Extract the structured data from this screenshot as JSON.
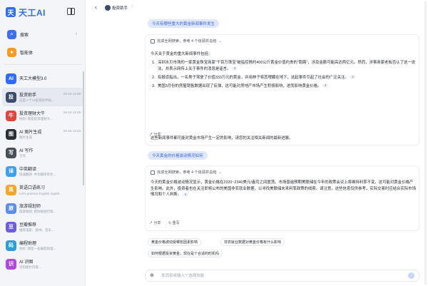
{
  "app": {
    "logo_text": "天工AI",
    "logo_mark": "天"
  },
  "sidebar": {
    "quick": [
      {
        "label": "搜索",
        "icon": "search-icon",
        "more": "›"
      },
      {
        "label": "智能体",
        "icon": "bolt-icon",
        "more": ""
      }
    ],
    "history": [
      {
        "title": "天工大模型3.0",
        "sub": "",
        "time": "",
        "color": "#2f6bff",
        "glyph": "AI",
        "active": false
      },
      {
        "title": "投资助手",
        "sub": "这是一个AI投资助手助...",
        "time": "04-16 13:48",
        "color": "#3b4b6b",
        "glyph": "投",
        "active": true
      },
      {
        "title": "投资理财大牛",
        "sub": "你好! 我是投资理财大...",
        "time": "04-16 13:45",
        "color": "#e0463c",
        "glyph": "牛",
        "active": false
      },
      {
        "title": "AI 图片生成",
        "sub": "图片生成",
        "time": "04-16 13:43",
        "color": "#2b2f36",
        "glyph": "图",
        "active": false
      },
      {
        "title": "AI 写作",
        "sub": "写作",
        "time": "",
        "color": "#4a4f57",
        "glyph": "写",
        "active": false
      },
      {
        "title": "中英翻译",
        "sub": "快速翻译: 中文翻译英文...",
        "time": "",
        "color": "#3aa0f0",
        "glyph": "译",
        "active": false
      },
      {
        "title": "英语口语练习",
        "sub": "Let's practice English togeth...",
        "time": "",
        "color": "#f5a623",
        "glyph": "英",
        "active": false
      },
      {
        "title": "旅游规划师",
        "sub": "旅游规划: 帮你规划行程...",
        "time": "",
        "color": "#5b8def",
        "glyph": "旅",
        "active": false
      },
      {
        "title": "豆瓣推荐",
        "sub": "推荐电影、图书、音乐...",
        "time": "",
        "color": "#6c5ce7",
        "glyph": "豆",
        "active": false
      },
      {
        "title": "编程助理",
        "sub": "你好, 我是一名编程助理...",
        "time": "",
        "color": "#2d9cdb",
        "glyph": "码",
        "active": false
      },
      {
        "title": "AI 识图",
        "sub": "识别图片内容...",
        "time": "",
        "color": "#b04adf",
        "glyph": "识",
        "active": false
      }
    ]
  },
  "header": {
    "back": "‹",
    "bot_name": "投资助手",
    "star": "☆"
  },
  "chat": {
    "q1": "今天有哪些重大的黄金新闻事件发生",
    "a1": {
      "refs": "完成全网搜索，参考 4 个信源并总结",
      "intro": "今天关于黄金的重大新闻事件包括：",
      "items": [
        {
          "n": "1.",
          "text": "深圳水贝市场的一家黄金珠宝商家“千百万珠宝”被指控携约400公斤黄金价值约贵的“跑路”，涉及金额可能高达两亿元。然而，涉事商家老板否认了这一说法，并表示网传上关于事件的消息是谣言。",
          "tag": "4"
        },
        {
          "n": "2.",
          "text": "有报道指出，一名男子驾驶了价值333万元的黄金，并用林子将其埋藏在地下，这起事件引起了社会的广泛关注。",
          "tag": "4"
        },
        {
          "n": "3.",
          "text": "美国3月份的房屋销售数据出现了反弹，这可能对房地产市场产生积极影响，进而影响黄金价格。",
          "tag": "4"
        }
      ],
      "outro": "这些新闻事件都可能对黄金市场产生一定的影响，请您的关注相关新闻的最新进展。",
      "share": "↗ 分享"
    },
    "q2": "今天黄金的价格波动情况如何",
    "a2": {
      "refs": "完成全网搜索，参考 4 个信源并总结",
      "text": "今天的黄金价格波动情况显示，黄金价格在2320~2340美元/盎司之间震荡。市场普遍预期美联储在今年的政策会议上将维持利率不变，这可能对黄金价格产生影响。此外，投资者也在关注即将公布的美国非农就业数据，以寻找美联储未来利率政策的线索。请注意，这些信息仅供参考，实际交易时应结合实际市场情况和个人判断。",
      "tag": "4",
      "share": "↗ 分享",
      "retry": "↻ 重写"
    },
    "suggestions": [
      "黄金价格波动受哪些因素影响",
      "非农就业数据对黄金价格有什么影响",
      "如何根据投资黄金，现在是个合适的时机吗"
    ]
  },
  "input": {
    "placeholder": "发消息或输入“/”选择技能",
    "send": "↑",
    "icon": "⊕"
  }
}
